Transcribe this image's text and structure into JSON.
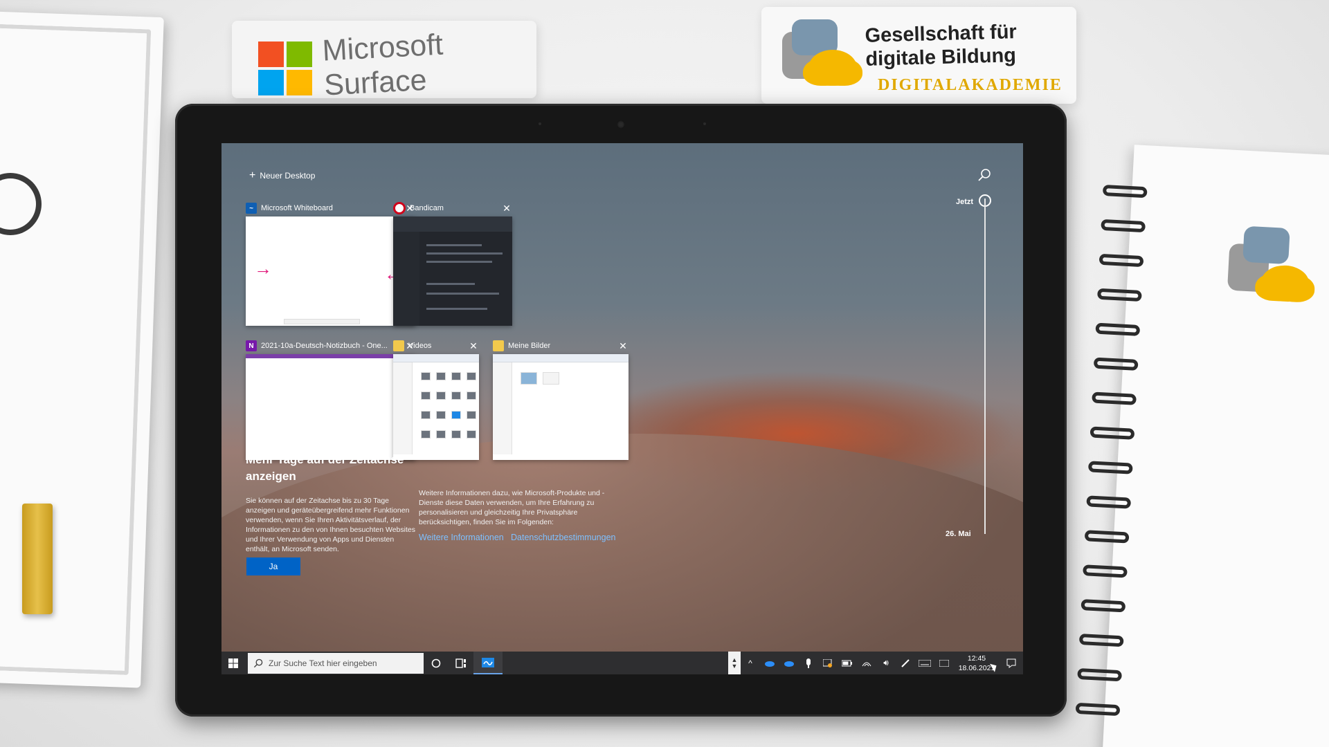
{
  "props": {
    "surface_card": {
      "brand_text": "Microsoft\nSurface"
    },
    "gdb_card": {
      "title": "Gesellschaft für\ndigitale Bildung",
      "subtitle": "DIGITALAKADEMIE"
    }
  },
  "task_view": {
    "new_desktop_label": "Neuer Desktop",
    "timeline": {
      "now_label": "Jetzt",
      "date_label": "26. Mai"
    },
    "windows": [
      {
        "app": "Microsoft Whiteboard",
        "icon": "whiteboard-icon"
      },
      {
        "app": "Bandicam",
        "icon": "bandicam-record-icon"
      },
      {
        "app": "2021-10a-Deutsch-Notizbuch - One...",
        "icon": "onenote-icon"
      },
      {
        "app": "Videos",
        "icon": "folder-icon"
      },
      {
        "app": "Meine Bilder",
        "icon": "folder-icon"
      }
    ],
    "promo": {
      "title": "Mehr Tage auf der Zeitachse anzeigen",
      "text": "Sie können auf der Zeitachse bis zu 30 Tage anzeigen und geräteübergreifend mehr Funktionen verwenden, wenn Sie Ihren Aktivitätsverlauf, der Informationen zu den von Ihnen besuchten Websites und Ihrer Verwendung von Apps und Diensten enthält, an Microsoft senden.",
      "button_label": "Ja",
      "info_text": "Weitere Informationen dazu, wie Microsoft-Produkte und -Dienste diese Daten verwenden, um Ihre Erfahrung zu personalisieren und gleichzeitig Ihre Privatsphäre berücksichtigen, finden Sie im Folgenden:",
      "link_more": "Weitere Informationen",
      "link_privacy": "Datenschutzbestimmungen"
    }
  },
  "taskbar": {
    "search_placeholder": "Zur Suche Text hier eingeben",
    "time": "12:45",
    "date": "18.06.2021"
  },
  "colors": {
    "accent": "#0063c6",
    "link": "#7ec0ff",
    "taskbar": "#2e2e30"
  }
}
